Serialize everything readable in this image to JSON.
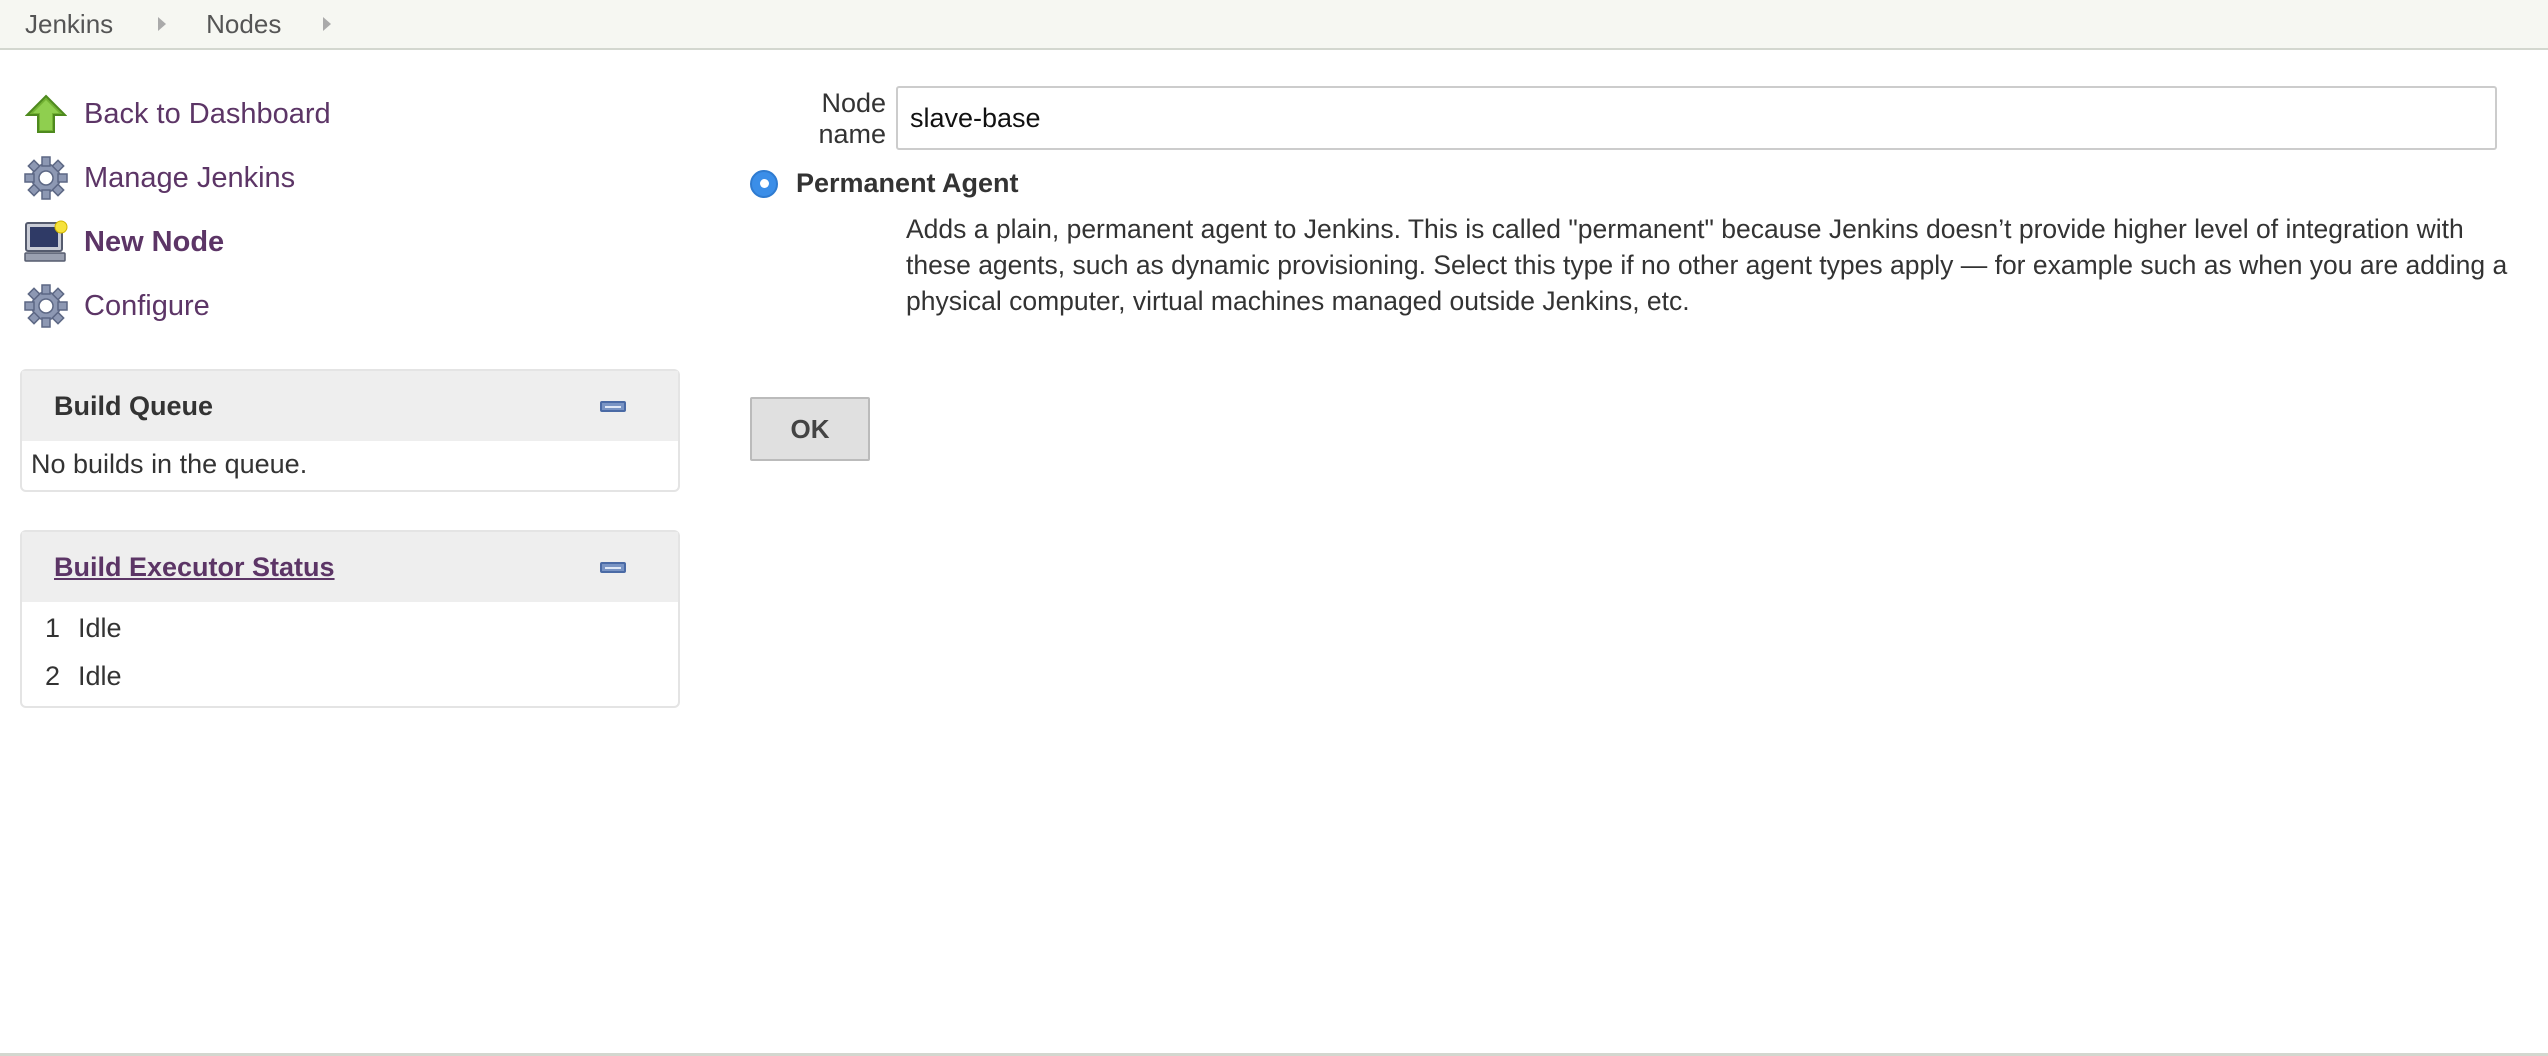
{
  "breadcrumb": {
    "items": [
      "Jenkins",
      "Nodes"
    ]
  },
  "tasks": [
    {
      "label": "Back to Dashboard",
      "icon": "up-arrow-icon"
    },
    {
      "label": "Manage Jenkins",
      "icon": "gear-icon"
    },
    {
      "label": "New Node",
      "icon": "computer-new-icon"
    },
    {
      "label": "Configure",
      "icon": "gear-icon"
    }
  ],
  "build_queue": {
    "title": "Build Queue",
    "empty_text": "No builds in the queue."
  },
  "executor_status": {
    "title": "Build Executor Status",
    "executors": [
      {
        "number": "1",
        "status": "Idle"
      },
      {
        "number": "2",
        "status": "Idle"
      }
    ]
  },
  "form": {
    "node_name_label": "Node name",
    "node_name_value": "slave-base",
    "agent_type_label": "Permanent Agent",
    "agent_type_description": "Adds a plain, permanent agent to Jenkins. This is called \"permanent\" because Jenkins doesn’t provide higher level of integration with these agents, such as dynamic provisioning. Select this type if no other agent types apply — for example such as when you are adding a physical computer, virtual machines managed outside Jenkins, etc.",
    "ok_label": "OK"
  },
  "colors": {
    "link": "#5c3566",
    "radio_selected": "#3b8ee8"
  }
}
